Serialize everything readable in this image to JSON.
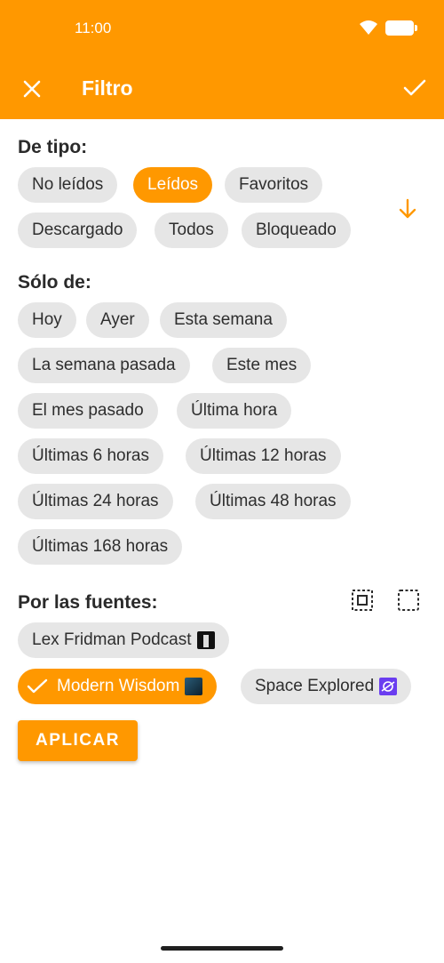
{
  "status_bar": {
    "time": "11:00"
  },
  "appbar": {
    "title": "Filtro"
  },
  "type_section": {
    "title": "De tipo:",
    "chips": [
      {
        "label": "No leídos",
        "selected": false
      },
      {
        "label": "Leídos",
        "selected": true
      },
      {
        "label": "Favoritos",
        "selected": false
      },
      {
        "label": "Descargado",
        "selected": false
      },
      {
        "label": "Todos",
        "selected": false
      },
      {
        "label": "Bloqueado",
        "selected": false
      }
    ]
  },
  "time_section": {
    "title": "Sólo de:",
    "chips": [
      {
        "label": "Hoy"
      },
      {
        "label": "Ayer"
      },
      {
        "label": "Esta semana"
      },
      {
        "label": "La semana pasada"
      },
      {
        "label": "Este mes"
      },
      {
        "label": "El mes pasado"
      },
      {
        "label": "Última hora"
      },
      {
        "label": "Últimas 6 horas"
      },
      {
        "label": "Últimas 12 horas"
      },
      {
        "label": "Últimas 24 horas"
      },
      {
        "label": "Últimas 48 horas"
      },
      {
        "label": "Últimas 168 horas"
      }
    ]
  },
  "sources_section": {
    "title": "Por las fuentes:",
    "chips": [
      {
        "label": "Lex Fridman Podcast",
        "selected": false
      },
      {
        "label": "Modern Wisdom",
        "selected": true
      },
      {
        "label": "Space Explored",
        "selected": false
      }
    ]
  },
  "apply_button": {
    "label": "APLICAR"
  },
  "colors": {
    "accent": "#FF9800",
    "chip_bg": "#e6e6e6",
    "text": "#2a2a2a"
  }
}
